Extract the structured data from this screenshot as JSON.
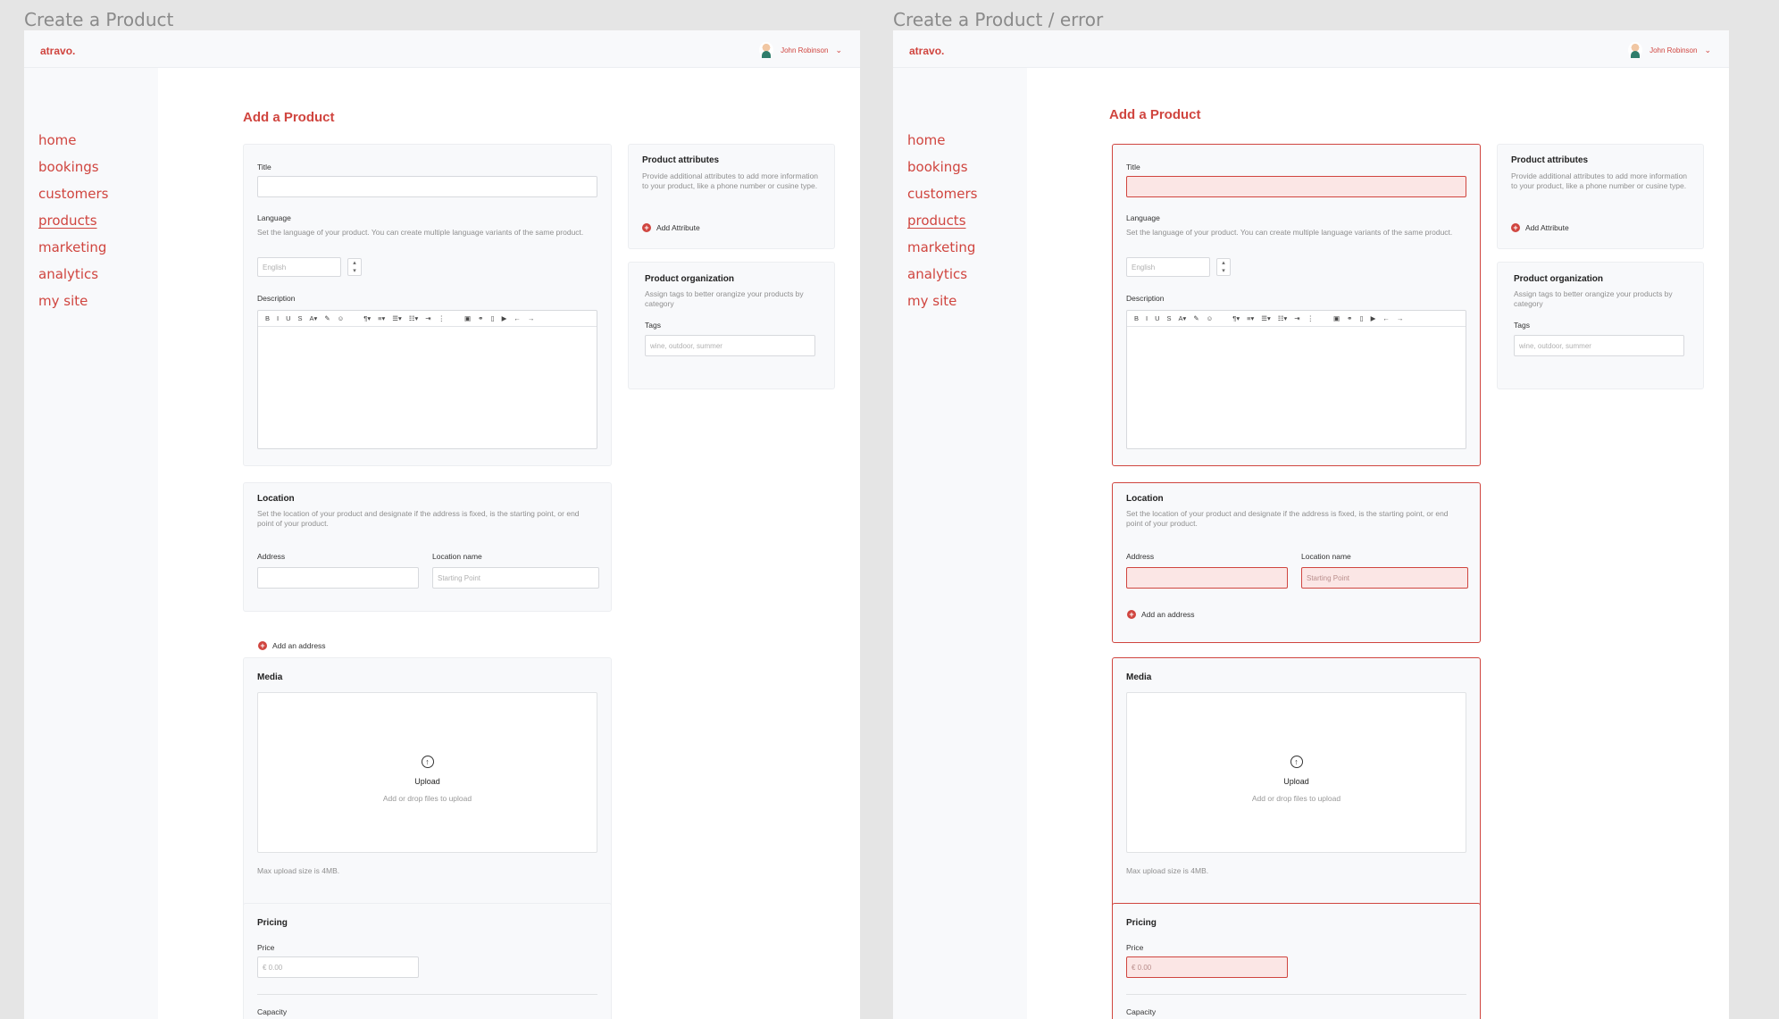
{
  "frames": [
    {
      "label": "Create a Product",
      "state": "default"
    },
    {
      "label": "Create a Product / error",
      "state": "error"
    }
  ],
  "app": {
    "logo": "atravo.",
    "user_name": "John Robinson",
    "nav": [
      "home",
      "bookings",
      "customers",
      "products",
      "marketing",
      "analytics",
      "my site"
    ],
    "active_nav": "products"
  },
  "page": {
    "title": "Add a Product"
  },
  "form": {
    "title_label": "Title",
    "language_label": "Language",
    "language_help": "Set the language of your product. You can create multiple language variants of the same product.",
    "language_value": "English",
    "description_label": "Description",
    "toolbar": [
      "B",
      "I",
      "U",
      "S",
      "A▾",
      "✎",
      "☺",
      "¶▾",
      "≡▾",
      "☰▾",
      "☷▾",
      "⇥",
      "⋮",
      "▣",
      "⚭",
      "▯",
      "▶",
      "←",
      "→"
    ],
    "location_title": "Location",
    "location_help": "Set the location of your product and designate if the address is fixed, is the starting point, or end point of your product.",
    "address_label": "Address",
    "location_name_label": "Location name",
    "location_name_placeholder": "Starting Point",
    "add_address": "Add an address",
    "media_title": "Media",
    "upload_title": "Upload",
    "upload_hint": "Add or drop files to upload",
    "max_upload": "Max upload size is 4MB.",
    "pricing_title": "Pricing",
    "price_label": "Price",
    "price_placeholder": "€  0.00",
    "capacity_label": "Capacity"
  },
  "side": {
    "attributes_title": "Product attributes",
    "attributes_help": "Provide additional attributes to add more information to your product, like a phone number or cusine type.",
    "add_attribute": "Add Attribute",
    "org_title": "Product organization",
    "org_help": "Assign tags to better orangize your products by category",
    "tags_label": "Tags",
    "tags_placeholder": "wine, outdoor, summer"
  },
  "colors": {
    "accent": "#d0453f",
    "error_fill": "#fbe6e5"
  }
}
